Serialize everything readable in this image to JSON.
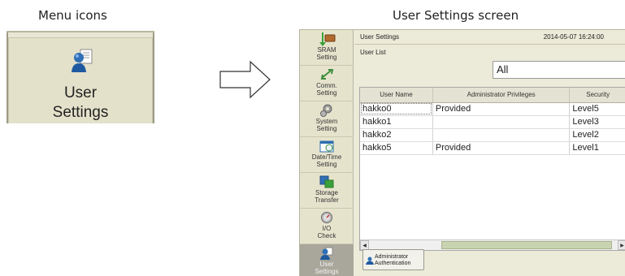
{
  "captions": {
    "menu_icons": "Menu icons",
    "user_settings_screen": "User Settings screen"
  },
  "menu_icon": {
    "label": "User\nSettings",
    "icon": "user-settings-icon"
  },
  "screen": {
    "title": "User Settings",
    "datetime": "2014-05-07  16:24:00",
    "sub_label": "User List",
    "filter": {
      "selected": "All"
    },
    "sidebar": {
      "items": [
        {
          "label": "SRAM\nSetting",
          "icon": "sram-icon"
        },
        {
          "label": "Comm.\nSetting",
          "icon": "comm-icon"
        },
        {
          "label": "System\nSetting",
          "icon": "gear-icon"
        },
        {
          "label": "Date/Time\nSetting",
          "icon": "calendar-icon"
        },
        {
          "label": "Storage\nTransfer",
          "icon": "storage-icon"
        },
        {
          "label": "I/O\nCheck",
          "icon": "gauge-icon"
        },
        {
          "label": "User\nSettings",
          "icon": "user-settings-icon"
        }
      ]
    },
    "table": {
      "headers": [
        "User Name",
        "Administrator Privileges",
        "Security"
      ],
      "rows": [
        [
          "hakko0",
          "Provided",
          "Level5"
        ],
        [
          "hakko1",
          "",
          "Level3"
        ],
        [
          "hakko2",
          "",
          "Level2"
        ],
        [
          "hakko5",
          "Provided",
          "Level1"
        ]
      ]
    },
    "auth_button": "Administrator\nAuthentication"
  },
  "colors": {
    "panel_bg": "#e6e3cd",
    "active_item": "#a9a69b",
    "scroll_thumb": "#c8d4b0"
  }
}
